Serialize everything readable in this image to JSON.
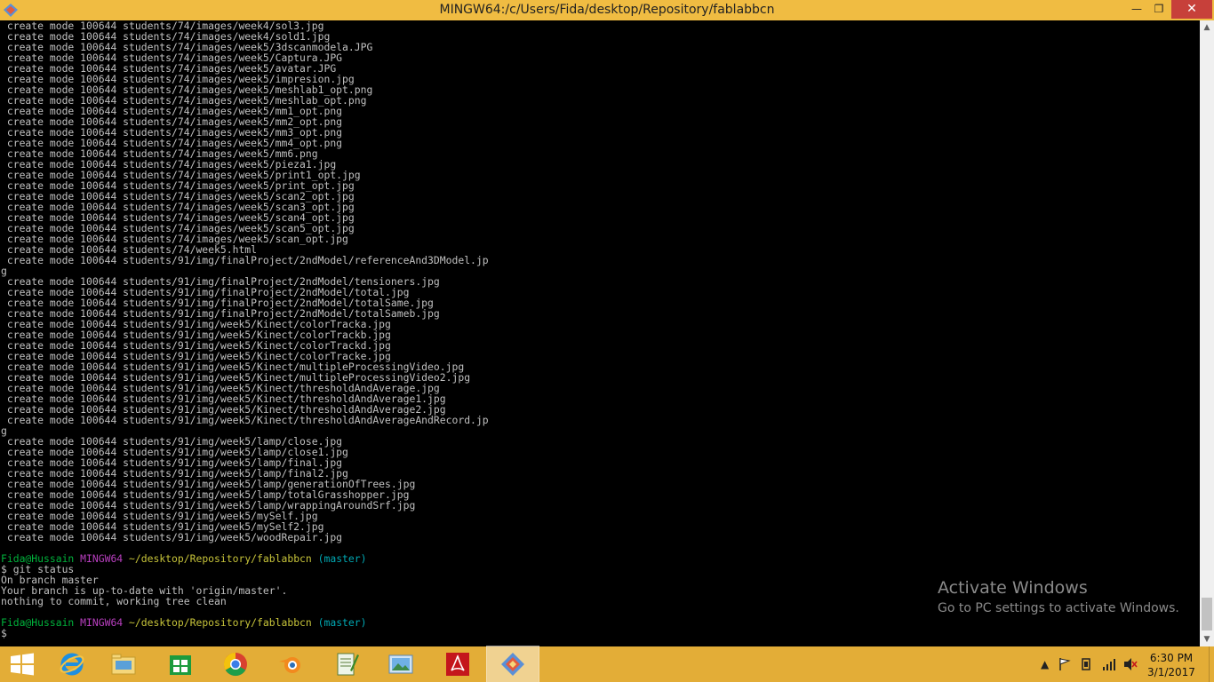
{
  "window": {
    "title": "MINGW64:/c/Users/Fida/desktop/Repository/fablabbcn"
  },
  "controls": {
    "minimize": "—",
    "maximize": "❐",
    "close": "✕"
  },
  "terminal": {
    "lines": [
      [
        {
          "t": " create mode 100644 students/74/images/week4/sol3.jpg"
        }
      ],
      [
        {
          "t": " create mode 100644 students/74/images/week4/sold1.jpg"
        }
      ],
      [
        {
          "t": " create mode 100644 students/74/images/week5/3dscanmodela.JPG"
        }
      ],
      [
        {
          "t": " create mode 100644 students/74/images/week5/Captura.JPG"
        }
      ],
      [
        {
          "t": " create mode 100644 students/74/images/week5/avatar.JPG"
        }
      ],
      [
        {
          "t": " create mode 100644 students/74/images/week5/impresion.jpg"
        }
      ],
      [
        {
          "t": " create mode 100644 students/74/images/week5/meshlab1_opt.png"
        }
      ],
      [
        {
          "t": " create mode 100644 students/74/images/week5/meshlab_opt.png"
        }
      ],
      [
        {
          "t": " create mode 100644 students/74/images/week5/mm1_opt.png"
        }
      ],
      [
        {
          "t": " create mode 100644 students/74/images/week5/mm2_opt.png"
        }
      ],
      [
        {
          "t": " create mode 100644 students/74/images/week5/mm3_opt.png"
        }
      ],
      [
        {
          "t": " create mode 100644 students/74/images/week5/mm4_opt.png"
        }
      ],
      [
        {
          "t": " create mode 100644 students/74/images/week5/mm6.png"
        }
      ],
      [
        {
          "t": " create mode 100644 students/74/images/week5/pieza1.jpg"
        }
      ],
      [
        {
          "t": " create mode 100644 students/74/images/week5/print1_opt.jpg"
        }
      ],
      [
        {
          "t": " create mode 100644 students/74/images/week5/print_opt.jpg"
        }
      ],
      [
        {
          "t": " create mode 100644 students/74/images/week5/scan2_opt.jpg"
        }
      ],
      [
        {
          "t": " create mode 100644 students/74/images/week5/scan3_opt.jpg"
        }
      ],
      [
        {
          "t": " create mode 100644 students/74/images/week5/scan4_opt.jpg"
        }
      ],
      [
        {
          "t": " create mode 100644 students/74/images/week5/scan5_opt.jpg"
        }
      ],
      [
        {
          "t": " create mode 100644 students/74/images/week5/scan_opt.jpg"
        }
      ],
      [
        {
          "t": " create mode 100644 students/74/week5.html"
        }
      ],
      [
        {
          "t": " create mode 100644 students/91/img/finalProject/2ndModel/referenceAnd3DModel.jp"
        }
      ],
      [
        {
          "t": "g"
        }
      ],
      [
        {
          "t": " create mode 100644 students/91/img/finalProject/2ndModel/tensioners.jpg"
        }
      ],
      [
        {
          "t": " create mode 100644 students/91/img/finalProject/2ndModel/total.jpg"
        }
      ],
      [
        {
          "t": " create mode 100644 students/91/img/finalProject/2ndModel/totalSame.jpg"
        }
      ],
      [
        {
          "t": " create mode 100644 students/91/img/finalProject/2ndModel/totalSameb.jpg"
        }
      ],
      [
        {
          "t": " create mode 100644 students/91/img/week5/Kinect/colorTracka.jpg"
        }
      ],
      [
        {
          "t": " create mode 100644 students/91/img/week5/Kinect/colorTrackb.jpg"
        }
      ],
      [
        {
          "t": " create mode 100644 students/91/img/week5/Kinect/colorTrackd.jpg"
        }
      ],
      [
        {
          "t": " create mode 100644 students/91/img/week5/Kinect/colorTracke.jpg"
        }
      ],
      [
        {
          "t": " create mode 100644 students/91/img/week5/Kinect/multipleProcessingVideo.jpg"
        }
      ],
      [
        {
          "t": " create mode 100644 students/91/img/week5/Kinect/multipleProcessingVideo2.jpg"
        }
      ],
      [
        {
          "t": " create mode 100644 students/91/img/week5/Kinect/thresholdAndAverage.jpg"
        }
      ],
      [
        {
          "t": " create mode 100644 students/91/img/week5/Kinect/thresholdAndAverage1.jpg"
        }
      ],
      [
        {
          "t": " create mode 100644 students/91/img/week5/Kinect/thresholdAndAverage2.jpg"
        }
      ],
      [
        {
          "t": " create mode 100644 students/91/img/week5/Kinect/thresholdAndAverageAndRecord.jp"
        }
      ],
      [
        {
          "t": "g"
        }
      ],
      [
        {
          "t": " create mode 100644 students/91/img/week5/lamp/close.jpg"
        }
      ],
      [
        {
          "t": " create mode 100644 students/91/img/week5/lamp/close1.jpg"
        }
      ],
      [
        {
          "t": " create mode 100644 students/91/img/week5/lamp/final.jpg"
        }
      ],
      [
        {
          "t": " create mode 100644 students/91/img/week5/lamp/final2.jpg"
        }
      ],
      [
        {
          "t": " create mode 100644 students/91/img/week5/lamp/generationOfTrees.jpg"
        }
      ],
      [
        {
          "t": " create mode 100644 students/91/img/week5/lamp/totalGrasshopper.jpg"
        }
      ],
      [
        {
          "t": " create mode 100644 students/91/img/week5/lamp/wrappingAroundSrf.jpg"
        }
      ],
      [
        {
          "t": " create mode 100644 students/91/img/week5/mySelf.jpg"
        }
      ],
      [
        {
          "t": " create mode 100644 students/91/img/week5/mySelf2.jpg"
        }
      ],
      [
        {
          "t": " create mode 100644 students/91/img/week5/woodRepair.jpg"
        }
      ],
      [
        {
          "t": ""
        }
      ],
      [
        {
          "t": "Fida@Hussain",
          "c": "green"
        },
        {
          "t": " "
        },
        {
          "t": "MINGW64",
          "c": "magenta"
        },
        {
          "t": " "
        },
        {
          "t": "~/desktop/Repository/fablabbcn",
          "c": "yellow"
        },
        {
          "t": " "
        },
        {
          "t": "(master)",
          "c": "cyan"
        }
      ],
      [
        {
          "t": "$ git status"
        }
      ],
      [
        {
          "t": "On branch master"
        }
      ],
      [
        {
          "t": "Your branch is up-to-date with 'origin/master'."
        }
      ],
      [
        {
          "t": "nothing to commit, working tree clean"
        }
      ],
      [
        {
          "t": ""
        }
      ],
      [
        {
          "t": "Fida@Hussain",
          "c": "green"
        },
        {
          "t": " "
        },
        {
          "t": "MINGW64",
          "c": "magenta"
        },
        {
          "t": " "
        },
        {
          "t": "~/desktop/Repository/fablabbcn",
          "c": "yellow"
        },
        {
          "t": " "
        },
        {
          "t": "(master)",
          "c": "cyan"
        }
      ],
      [
        {
          "t": "$"
        }
      ]
    ]
  },
  "scrollbar": {
    "up": "▲",
    "down": "▼"
  },
  "watermark": {
    "title": "Activate Windows",
    "subtitle": "Go to PC settings to activate Windows."
  },
  "taskbar": {
    "apps": [
      {
        "name": "start-button",
        "icon": "windows-logo-icon"
      },
      {
        "name": "taskbar-ie",
        "icon": "internet-explorer-icon"
      },
      {
        "name": "taskbar-file-explorer",
        "icon": "folder-icon"
      },
      {
        "name": "taskbar-store",
        "icon": "store-icon"
      },
      {
        "name": "taskbar-chrome",
        "icon": "chrome-icon"
      },
      {
        "name": "taskbar-blender",
        "icon": "blender-icon"
      },
      {
        "name": "taskbar-notepad",
        "icon": "notepad-icon"
      },
      {
        "name": "taskbar-photo-viewer",
        "icon": "photo-viewer-icon"
      },
      {
        "name": "taskbar-acrobat",
        "icon": "acrobat-icon"
      },
      {
        "name": "taskbar-git-bash",
        "icon": "git-bash-icon",
        "active": true
      }
    ],
    "tray": {
      "chevron": "▲"
    },
    "clock": {
      "time": "6:30 PM",
      "date": "3/1/2017"
    }
  },
  "colors": {
    "titlebar": "#f0bc42",
    "taskbar": "#e3ad37",
    "terminal_bg": "#000000",
    "text": "#c0c0c0",
    "prompt_user": "#00b33c",
    "prompt_host": "#b83fbf",
    "prompt_path": "#c7c43a",
    "prompt_branch": "#00a8b3"
  }
}
